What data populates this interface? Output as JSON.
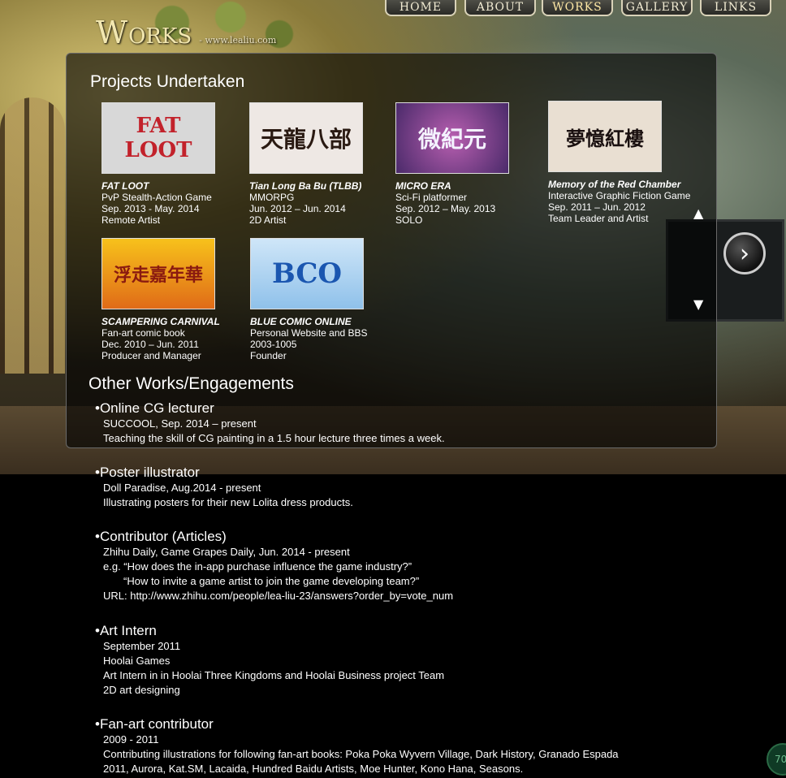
{
  "site": {
    "logo_big": "W",
    "logo_rest": "ORKS",
    "logo_url": "- www.lealiu.com"
  },
  "nav": [
    {
      "label": "Home"
    },
    {
      "label": "About"
    },
    {
      "label": "Works"
    },
    {
      "label": "Gallery"
    },
    {
      "label": "Links"
    }
  ],
  "projects_title": "Projects Undertaken",
  "projects": [
    {
      "thumb_text": "FAT LOOT",
      "thumb_color": "#c2222b",
      "title": "FAT LOOT",
      "l1": "PvP Stealth-Action Game",
      "l2": "Sep. 2013 - May. 2014",
      "l3": "Remote Artist"
    },
    {
      "thumb_text": "天龍八部",
      "thumb_color": "#2a1a12",
      "title": "Tian Long Ba Bu (TLBB)",
      "l1": "MMORPG",
      "l2": "Jun. 2012 – Jun. 2014",
      "l3": "2D Artist"
    },
    {
      "thumb_text": "微紀元",
      "thumb_color": "#f4f2ff",
      "title": "MICRO ERA",
      "l1": "Sci-Fi platformer",
      "l2": "Sep. 2012 – May. 2013",
      "l3": "SOLO"
    },
    {
      "thumb_text": "夢憶紅樓",
      "thumb_color": "#1a1010",
      "title": "Memory of  the Red Chamber",
      "l1": "Interactive Graphic Fiction Game",
      "l2": "Sep. 2011 – Jun. 2012",
      "l3": "Team Leader and Artist"
    },
    {
      "thumb_text": "浮走嘉年華",
      "thumb_color": "#f7c21b",
      "title": "SCAMPERING CARNIVAL",
      "l1": "Fan-art comic book",
      "l2": "Dec. 2010 – Jun. 2011",
      "l3": "Producer and Manager"
    },
    {
      "thumb_text": "BCO",
      "thumb_color": "#1a56b0",
      "title": "BLUE COMIC ONLINE",
      "l1": "Personal Website and BBS",
      "l2": "2003-1005",
      "l3": "Founder"
    }
  ],
  "other_title": "Other Works/Engagements",
  "works": [
    {
      "head": "•Online CG lecturer",
      "lines": [
        "SUCCOOL, Sep. 2014 – present",
        "Teaching the skill of CG painting in a 1.5 hour lecture three times a week."
      ]
    },
    {
      "head": "•Poster illustrator",
      "lines": [
        "Doll Paradise, Aug.2014 - present",
        "Illustrating posters for their new Lolita dress products."
      ]
    },
    {
      "head": "•Contributor (Articles)",
      "lines": [
        "Zhihu Daily, Game Grapes Daily, Jun. 2014 - present",
        "e.g. “How does the in-app purchase influence the game industry?”",
        "“How to invite a game artist to join the game developing team?”",
        "URL: http://www.zhihu.com/people/lea-liu-23/answers?order_by=vote_num"
      ]
    },
    {
      "head": "•Art Intern",
      "lines": [
        "September 2011",
        "Hoolai Games",
        "Art Intern in in Hoolai Three Kingdoms and Hoolai Business project Team",
        "2D art designing"
      ]
    },
    {
      "head": "•Fan-art contributor",
      "lines": [
        "2009 - 2011",
        "Contributing illustrations for following fan-art books: Poka Poka Wyvern Village, Dark History, Granado Espada",
        "2011, Aurora, Kat.SM, Lacaida, Hundred Baidu Artists, Moe Hunter, Kono Hana, Seasons."
      ]
    }
  ],
  "icons": {
    "up": "▲",
    "down": "▼",
    "next": "›"
  },
  "badge": "70"
}
